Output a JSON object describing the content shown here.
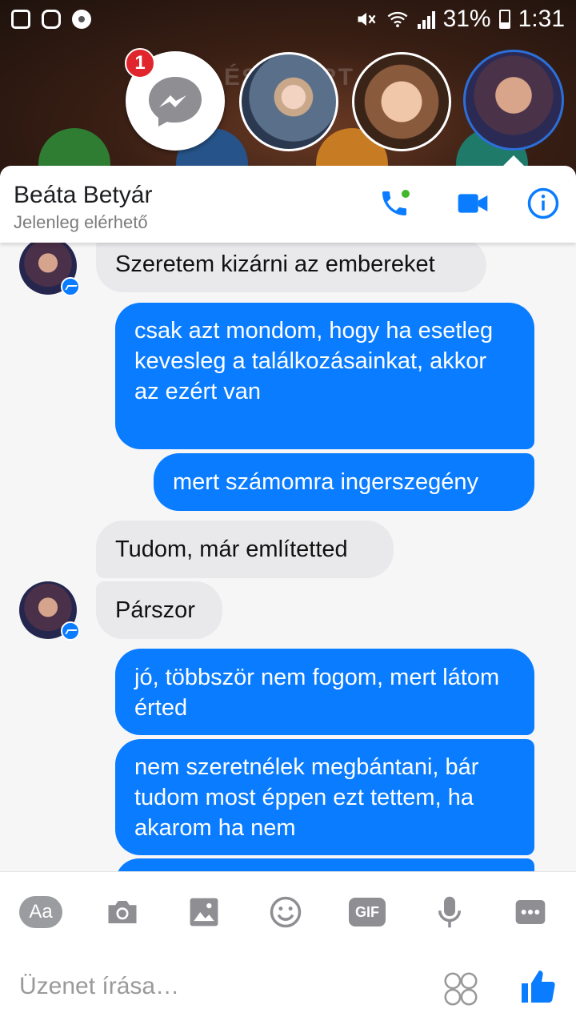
{
  "status_bar": {
    "battery": "31%",
    "time": "1:31",
    "icons": [
      "gallery-icon",
      "instagram-icon",
      "music-icon",
      "mute-icon",
      "wifi-icon",
      "signal-icon",
      "battery-icon"
    ]
  },
  "background": {
    "text": "ÉS -Z ERT"
  },
  "chat_heads": {
    "badge_count": "1"
  },
  "header": {
    "name": "Beáta Betyár",
    "status": "Jelenleg elérhető",
    "accent": "#0a7cff"
  },
  "messages": [
    {
      "dir": "in",
      "text": "Szeretem kizárni az embereket"
    },
    {
      "dir": "out",
      "text": "csak azt mondom, hogy ha esetleg kevesleg a találkozásainkat, akkor az ezért van"
    },
    {
      "dir": "out",
      "text": "mert számomra ingerszegény"
    },
    {
      "dir": "in",
      "text": "Tudom, már említetted"
    },
    {
      "dir": "in",
      "text": "Párszor"
    },
    {
      "dir": "out",
      "text": "jó, többször nem fogom, mert látom érted"
    },
    {
      "dir": "out",
      "text": "nem szeretnélek megbántani, bár tudom most éppen ezt tettem, ha akarom ha nem"
    }
  ],
  "composer": {
    "aa_label": "Aa",
    "gif_label": "GIF",
    "placeholder": "Üzenet írása…"
  },
  "colors": {
    "outgoing": "#0a7cff",
    "incoming": "#e9e9eb",
    "online": "#42b72a",
    "badge": "#e0262c"
  }
}
